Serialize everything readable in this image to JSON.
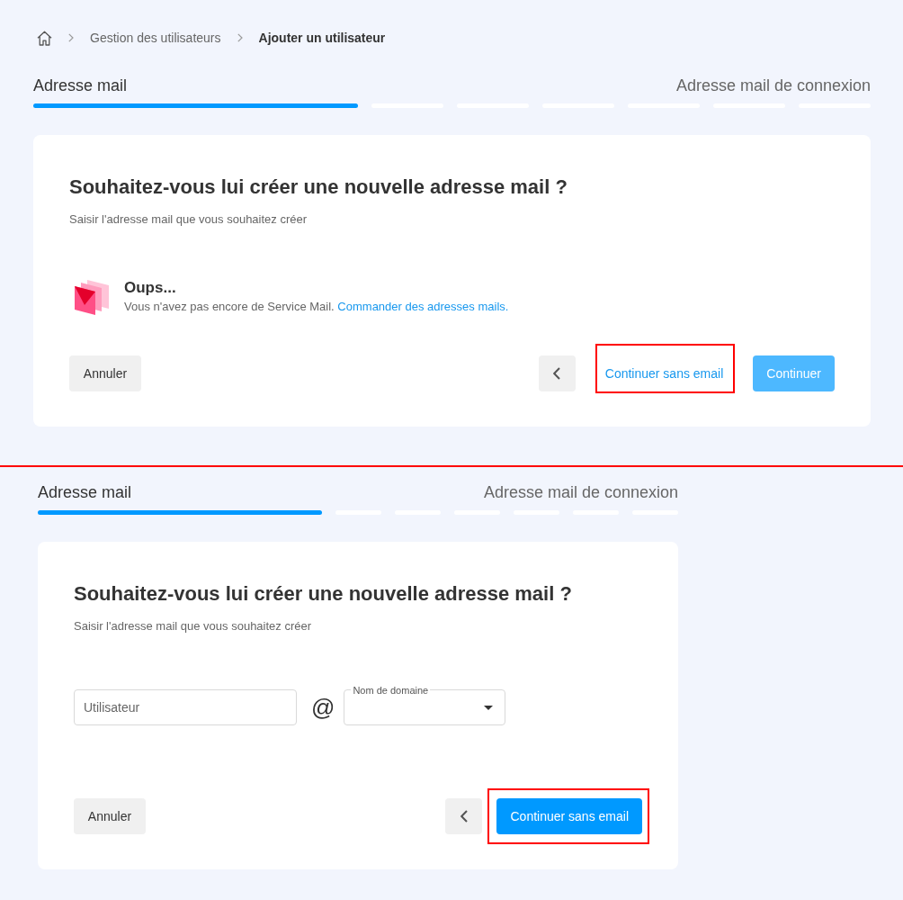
{
  "breadcrumb": [
    {
      "kind": "home"
    },
    {
      "kind": "link",
      "label": "Gestion des utilisateurs"
    },
    {
      "kind": "current",
      "label": "Ajouter un utilisateur"
    }
  ],
  "panels": [
    {
      "stepper": {
        "current_step": "Adresse mail",
        "last_step": "Adresse mail de connexion",
        "segments": [
          {
            "selected": true
          },
          {
            "selected": false
          },
          {
            "selected": false
          },
          {
            "selected": false
          },
          {
            "selected": false
          },
          {
            "selected": false
          },
          {
            "selected": false
          }
        ]
      },
      "card": {
        "title": "Souhaitez-vous lui créer une nouvelle adresse mail ?",
        "subtitle": "Saisir l'adresse mail que vous souhaitez créer",
        "body": {
          "kind": "notice",
          "heading": "Oups...",
          "text": "Vous n'avez pas encore de Service Mail.",
          "link": "Commander des adresses mails."
        },
        "actions": [
          {
            "kind": "secondary",
            "label": "Annuler",
            "disabled": false,
            "highlighted": false
          },
          {
            "kind": "back",
            "disabled": false,
            "highlighted": false
          },
          {
            "kind": "link",
            "label": "Continuer sans email",
            "disabled": false,
            "highlighted": true
          },
          {
            "kind": "primary",
            "label": "Continuer",
            "disabled": true,
            "highlighted": false
          }
        ]
      }
    },
    {
      "stepper": {
        "current_step": "Adresse mail",
        "last_step": "Adresse mail de connexion",
        "segments": [
          {
            "selected": true
          },
          {
            "selected": false
          },
          {
            "selected": false
          },
          {
            "selected": false
          },
          {
            "selected": false
          },
          {
            "selected": false
          },
          {
            "selected": false
          }
        ]
      },
      "card": {
        "title": "Souhaitez-vous lui créer une nouvelle adresse mail ?",
        "subtitle": "Saisir l'adresse mail que vous souhaitez créer",
        "body": {
          "kind": "form",
          "user_field": {
            "placeholder": "Utilisateur"
          },
          "separator": "@",
          "domain_select": {
            "label": "Nom de domaine"
          }
        },
        "actions": [
          {
            "kind": "secondary",
            "label": "Annuler",
            "disabled": false,
            "highlighted": false
          },
          {
            "kind": "back",
            "disabled": false,
            "highlighted": false
          },
          {
            "kind": "primary",
            "label": "Continuer sans email",
            "disabled": false,
            "highlighted": true
          }
        ]
      }
    }
  ]
}
